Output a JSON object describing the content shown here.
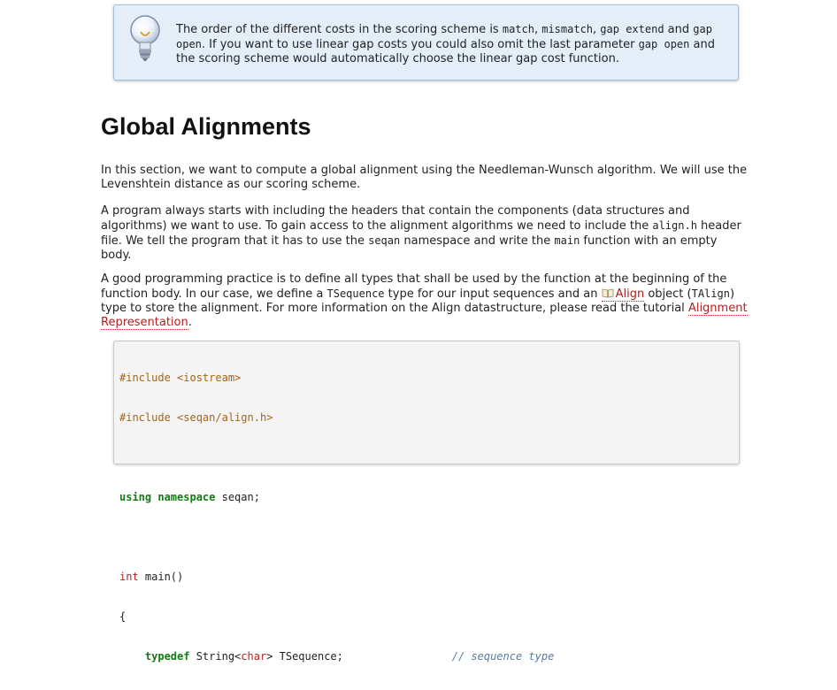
{
  "tip": {
    "icon": "lightbulb-icon",
    "text_1": "The order of the different costs in the scoring scheme is ",
    "code_match": "match",
    "text_2": ", ",
    "code_mismatch": "mismatch",
    "text_3": ", ",
    "code_gap_extend": "gap extend",
    "text_4": " and ",
    "code_gap_open": "gap open",
    "text_5": ". If you want to use linear gap costs you could also omit the last parameter ",
    "code_gap_open_2": "gap open",
    "text_6": " and the scoring scheme would automatically choose the linear gap cost function."
  },
  "section": {
    "title": "Global Alignments"
  },
  "paragraph1": {
    "text": "In this section, we want to compute a global alignment using the Needleman-Wunsch algorithm. We will use the Levenshtein distance as our scoring scheme."
  },
  "paragraph2": {
    "text_1": "A program always starts with including the headers that contain the components (data structures and algorithms) we want to use. To gain access to the alignment algorithms we need to include the ",
    "code_align_h": "align.h",
    "text_2": " header file. We tell the program that it has to use the ",
    "code_seqan": "seqan",
    "text_3": " namespace and write the ",
    "code_main": "main",
    "text_4": " function with an empty body."
  },
  "paragraph3": {
    "text_1": "A good programming practice is to define all types that shall be used by the function at the beginning of the function body. In our case, we define a ",
    "code_tsequence": "TSequence",
    "text_2": " type for our input sequences and an ",
    "link_align": "Align",
    "text_3": " object (",
    "code_talign": "TAlign",
    "text_4": ") type to store the alignment. For more information on the Align datastructure, please read the tutorial ",
    "link_alignment_repr": "Alignment Representation",
    "text_5": "."
  },
  "code": {
    "include_1": "#include <iostream>",
    "include_2": "#include <seqan/align.h>",
    "using_kw": "using namespace",
    "using_rest": " seqan;",
    "int_kw": "int",
    "main_rest": " main()",
    "brace_open": "{",
    "indent": "    ",
    "typedef_kw": "typedef",
    "string_type": " String<",
    "char_type": "char",
    "tsequence_decl": "> TSequence;",
    "pad": "                 ",
    "comment": "// sequence type"
  },
  "colors": {
    "tip_bg": "#e3eef9",
    "link": "#b41d1d",
    "preprocessor": "#a3641a",
    "keyword": "#157a15",
    "type": "#b82525",
    "comment": "#5a7aa0"
  }
}
